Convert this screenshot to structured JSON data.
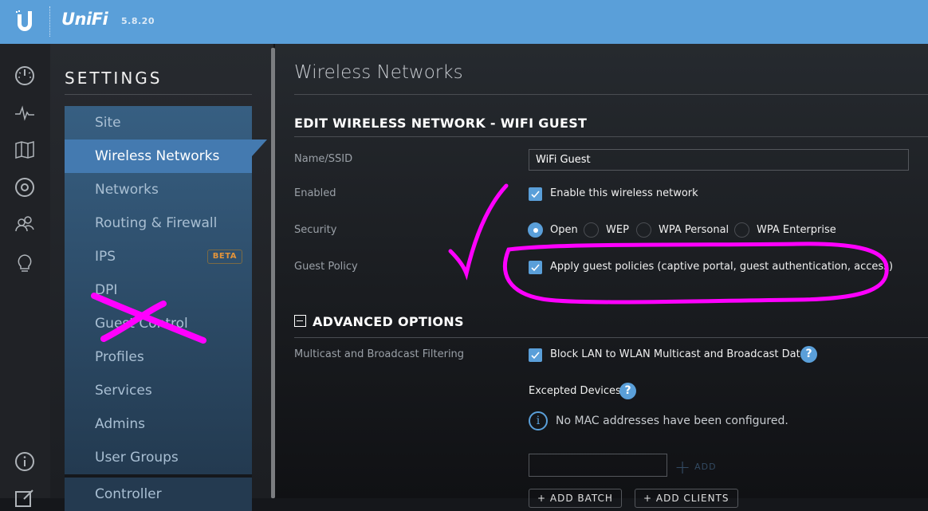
{
  "topbar": {
    "brand": "UniFi",
    "version": "5.8.20"
  },
  "iconrail": {
    "items": [
      "dashboard-icon",
      "statistics-icon",
      "map-icon",
      "devices-icon",
      "clients-icon",
      "insights-icon"
    ],
    "bottom": [
      "info-icon",
      "edit-icon"
    ]
  },
  "settings": {
    "title": "SETTINGS",
    "items": [
      {
        "label": "Site"
      },
      {
        "label": "Wireless Networks",
        "active": true
      },
      {
        "label": "Networks"
      },
      {
        "label": "Routing & Firewall"
      },
      {
        "label": "IPS",
        "badge": "BETA"
      },
      {
        "label": "DPI"
      },
      {
        "label": "Guest Control"
      },
      {
        "label": "Profiles"
      },
      {
        "label": "Services"
      },
      {
        "label": "Admins"
      },
      {
        "label": "User Groups"
      }
    ],
    "group2": [
      {
        "label": "Controller"
      }
    ]
  },
  "main": {
    "page_title": "Wireless Networks",
    "section_title": "EDIT WIRELESS NETWORK - WIFI GUEST",
    "fields": {
      "name_label": "Name/SSID",
      "name_value": "WiFi Guest",
      "enabled_label": "Enabled",
      "enabled_text": "Enable this wireless network",
      "enabled_checked": true,
      "security_label": "Security",
      "security_options": [
        "Open",
        "WEP",
        "WPA Personal",
        "WPA Enterprise"
      ],
      "security_selected": "Open",
      "guest_label": "Guest Policy",
      "guest_text": "Apply guest policies (captive portal, guest authentication, access)",
      "guest_checked": true
    },
    "advanced": {
      "title": "ADVANCED OPTIONS",
      "multicast_label": "Multicast and Broadcast Filtering",
      "multicast_text": "Block LAN to WLAN Multicast and Broadcast Data",
      "multicast_checked": true,
      "excepted_label": "Excepted Devices",
      "no_mac_text": "No MAC addresses have been configured.",
      "mac_input_value": "",
      "add_label": "ADD",
      "add_batch_label": "ADD BATCH",
      "add_clients_label": "ADD CLIENTS",
      "help_glyph": "?",
      "info_glyph": "i"
    }
  },
  "colors": {
    "accent": "#5a9fd9",
    "active_nav": "#447ab0",
    "beta": "#e3943a",
    "annotation": "#ff00ff"
  }
}
